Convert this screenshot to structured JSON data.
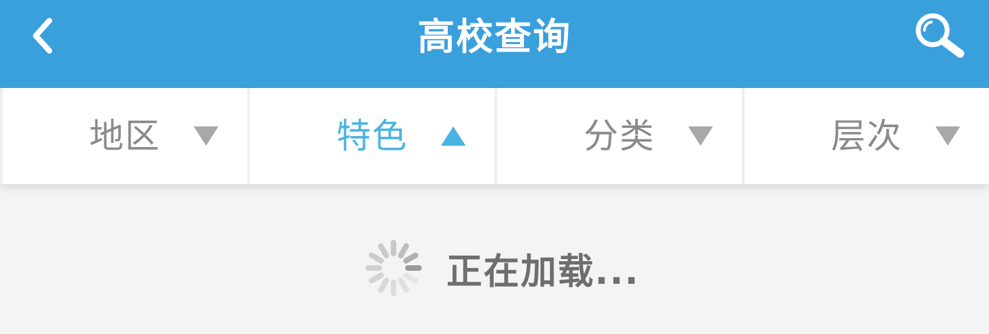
{
  "header": {
    "title": "高校查询",
    "back_icon": "chevron-left-icon",
    "search_icon": "search-icon",
    "background_color": "#3aa0dc",
    "text_color": "#ffffff"
  },
  "filters": {
    "items": [
      {
        "label": "地区",
        "state": "collapsed",
        "caret_icon": "triangle-down-icon"
      },
      {
        "label": "特色",
        "state": "expanded",
        "caret_icon": "triangle-up-icon"
      },
      {
        "label": "分类",
        "state": "collapsed",
        "caret_icon": "triangle-down-icon"
      },
      {
        "label": "层次",
        "state": "collapsed",
        "caret_icon": "triangle-down-icon"
      }
    ],
    "inactive_color": "#8a8a8a",
    "active_color": "#4ab4e0"
  },
  "loading": {
    "text": "正在加载...",
    "icon": "loading-spinner-icon"
  }
}
